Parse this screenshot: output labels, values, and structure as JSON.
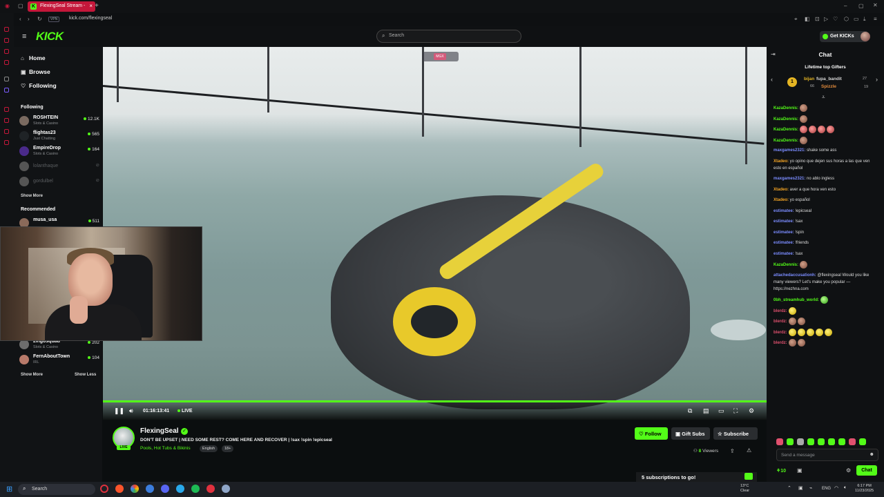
{
  "browser": {
    "tab_title": "FlexingSeal Stream - ",
    "tab_close": "×",
    "new_tab": "+",
    "url": "kick.com/flexingseal",
    "vpn_label": "VPN"
  },
  "header": {
    "logo_text": "KICK",
    "search_placeholder": "Search",
    "get_kicks_label": "Get KICKs"
  },
  "nav": {
    "main": [
      {
        "label": "Home",
        "icon": "home-icon",
        "glyph": "⌂"
      },
      {
        "label": "Browse",
        "icon": "browse-icon",
        "glyph": "▣"
      },
      {
        "label": "Following",
        "icon": "heart-icon",
        "glyph": "♡"
      }
    ],
    "following_title": "Following",
    "following": [
      {
        "name": "ROSHTEIN",
        "category": "Slots & Casino",
        "viewers": "12.1K",
        "live": true
      },
      {
        "name": "flightas23",
        "category": "Just Chatting",
        "viewers": "565",
        "live": true
      },
      {
        "name": "EmpireDrop",
        "category": "Slots & Casino",
        "viewers": "164",
        "live": true
      },
      {
        "name": "lolanthaque",
        "category": "",
        "viewers": "",
        "live": false
      },
      {
        "name": "gordulbel",
        "category": "",
        "viewers": "",
        "live": false
      }
    ],
    "show_more": "Show More",
    "recommended_title": "Recommended",
    "recommended": [
      {
        "name": "musa_usa",
        "category": "IRL",
        "viewers": "511"
      },
      {
        "name": "zingosquad",
        "category": "Slots & Casino",
        "viewers": "202"
      },
      {
        "name": "FernAboutTown",
        "category": "IRL",
        "viewers": "104"
      }
    ],
    "rec_show_more": "Show More",
    "rec_show_less": "Show Less"
  },
  "player": {
    "overlay_badge": "MGX",
    "timecode": "01:16:13:41",
    "live_label": "LIVE",
    "progress_fraction": 1.0
  },
  "stream": {
    "streamer": "FlexingSeal",
    "live_tag": "LIVE",
    "title": "DON'T BE UPSET | NEED SOME REST? COME HERE AND RECOVER | !sax !spin !epicseal",
    "category": "Pools, Hot Tubs & Bikinis",
    "tags": [
      "English",
      "18+"
    ],
    "follow_label": "Follow",
    "gift_subs_label": "Gift Subs",
    "subscribe_label": "Subscribe",
    "viewers": "8",
    "viewers_suffix": " Viewers",
    "subs_goal": "5 subscriptions to go!"
  },
  "chat": {
    "title": "Chat",
    "gifters_title": "Lifetime top Gifters",
    "gifters": [
      {
        "name": "bijan",
        "count": "66",
        "color": "#e5b523"
      },
      {
        "name": "fupa_bandit",
        "count": "27",
        "color": "#d7d7d7"
      },
      {
        "name": "Spizzle",
        "count": "19",
        "color": "#e08a3c"
      }
    ],
    "messages": [
      {
        "user": "KazaDennis:",
        "color": "#53fc18",
        "text": "",
        "emotes": 1
      },
      {
        "user": "KazaDennis:",
        "color": "#53fc18",
        "text": "",
        "emotes": 1
      },
      {
        "user": "KazaDennis:",
        "color": "#53fc18",
        "text": "",
        "emotes": 4,
        "emote_style": "red"
      },
      {
        "user": "KazaDennis:",
        "color": "#53fc18",
        "text": "",
        "emotes": 1
      },
      {
        "user": "maxgames2321:",
        "color": "#7b8cff",
        "text": " shake some ass"
      },
      {
        "user": "Xtadeo:",
        "color": "#f5a524",
        "text": " yo opino que dejen sus horas a las que ven esto en español"
      },
      {
        "user": "maxgames2321:",
        "color": "#7b8cff",
        "text": " no ablo ingless"
      },
      {
        "user": "Xtadeo:",
        "color": "#f5a524",
        "text": " aver a que hora ven esto"
      },
      {
        "user": "Xtadeo:",
        "color": "#f5a524",
        "text": " yo español"
      },
      {
        "user": "estimatee:",
        "color": "#7b8cff",
        "text": " !epicseal"
      },
      {
        "user": "estimatee:",
        "color": "#7b8cff",
        "text": " !sax"
      },
      {
        "user": "estimatee:",
        "color": "#7b8cff",
        "text": " !spin"
      },
      {
        "user": "estimatee:",
        "color": "#7b8cff",
        "text": " !friends"
      },
      {
        "user": "estimatee:",
        "color": "#7b8cff",
        "text": " !sax"
      },
      {
        "user": "KazaDennis:",
        "color": "#53fc18",
        "text": "",
        "emotes": 1
      },
      {
        "user": "attachedaccusationh:",
        "color": "#7b8cff",
        "text": " @flexingseal Would you like many viewers? Let's make you popular — https://nezhna.com"
      },
      {
        "user": "0bh_streamhub_world:",
        "color": "#53fc18",
        "text": "",
        "emotes": 1,
        "emote_style": "grn"
      },
      {
        "user": "blerdz:",
        "color": "#e0506e",
        "text": "",
        "emotes": 1,
        "emote_style": "yel"
      },
      {
        "user": "blerdz:",
        "color": "#e0506e",
        "text": "",
        "emotes": 2
      },
      {
        "user": "blerdz:",
        "color": "#e0506e",
        "text": "",
        "emotes": 5,
        "emote_style": "yel"
      },
      {
        "user": "blerdz:",
        "color": "#e0506e",
        "text": "",
        "emotes": 2
      }
    ],
    "input_placeholder": "Send a message",
    "kicks_count": "10",
    "send_label": "Chat"
  },
  "taskbar": {
    "search_label": "Search",
    "weather_temp": "13°C",
    "weather_desc": "Clear",
    "lang": "ENG",
    "time": "6:17 PM",
    "date": "11/23/2025"
  },
  "colors": {
    "accent": "#53fc18",
    "tab_red": "#c4173a",
    "background": "#0b0e0f"
  }
}
